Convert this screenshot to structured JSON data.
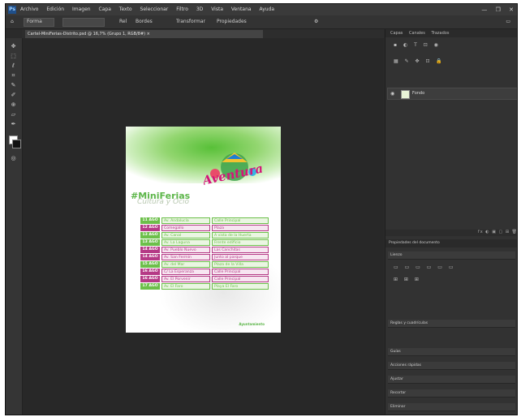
{
  "app": {
    "logo_label": "Ps",
    "menu": [
      "Archivo",
      "Edición",
      "Imagen",
      "Capa",
      "Texto",
      "Seleccionar",
      "Filtro",
      "3D",
      "Vista",
      "Ventana",
      "Ayuda"
    ],
    "window_controls": [
      "—",
      "❐",
      "✕"
    ]
  },
  "options_bar": {
    "mode_label": "Forma",
    "items": [
      "Rel",
      "Bordes",
      "Transformar",
      "Propiedades"
    ]
  },
  "document_tab": {
    "label": "Cartel-MiniFerias-Distrito.psd @ 16,7% (Grupo 1, RGB/8#) ×"
  },
  "flyer": {
    "title": "#MiniFerias",
    "subtitle": "Cultura y Ocio",
    "logo_text": "Aventura",
    "rows": [
      {
        "date": "11 AGO",
        "place": "Av. Andalucía",
        "addr": "Calle Principal",
        "tone": "green"
      },
      {
        "date": "12 AGO",
        "place": "Comegallo",
        "addr": "Plaza",
        "tone": "pink"
      },
      {
        "date": "13 AGO",
        "place": "Av. Canal",
        "addr": "A vista de la Huerta",
        "tone": "green"
      },
      {
        "date": "13 AGO",
        "place": "Av. La Laguna",
        "addr": "Frente edificio",
        "tone": "green"
      },
      {
        "date": "14 AGO",
        "place": "Av. Pueblo Nuevo",
        "addr": "Las Canchitas",
        "tone": "pink"
      },
      {
        "date": "14 AGO",
        "place": "Av. San Fermín",
        "addr": "Junto al parque",
        "tone": "pink"
      },
      {
        "date": "15 AGO",
        "place": "Av. del Mar",
        "addr": "Plaza de la Villa",
        "tone": "green"
      },
      {
        "date": "16 AGO",
        "place": "C/ La Esperanza",
        "addr": "Calle Principal",
        "tone": "pink"
      },
      {
        "date": "16 AGO",
        "place": "Av. El Porvenir",
        "addr": "Calle Principal",
        "tone": "pink"
      },
      {
        "date": "17 AGO",
        "place": "Av. El Faro",
        "addr": "Playa El Faro",
        "tone": "green"
      }
    ],
    "footer": "Ayuntamiento"
  },
  "panels": {
    "tabs": [
      "Capas",
      "Canales",
      "Trazados"
    ],
    "layer_name": "Fondo",
    "footer_icons": "fx ◐ ▣ ▢ ⊞ 🗑",
    "properties_header": "Propiedades del documento",
    "sections": [
      "Lienzo",
      "Reglas y cuadrículas",
      "Guías",
      "Acciones rápidas",
      "Ajustar",
      "Recortar",
      "Eliminar"
    ]
  },
  "colors": {
    "green": "#6cbf4a",
    "pink": "#b53a86",
    "green_light": "#eaf6e2",
    "pink_light": "#f7e6f1"
  }
}
